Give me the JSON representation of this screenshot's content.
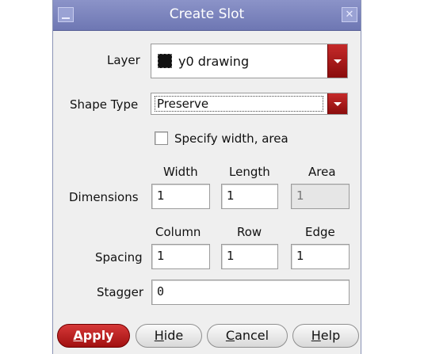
{
  "window": {
    "title": "Create Slot"
  },
  "layer": {
    "label": "Layer",
    "value": "y0 drawing"
  },
  "shape_type": {
    "label": "Shape Type",
    "value": "Preserve"
  },
  "specify": {
    "label": "Specify width, area",
    "checked": false
  },
  "dimensions": {
    "label": "Dimensions",
    "headers": [
      "Width",
      "Length",
      "Area"
    ],
    "values": [
      "1",
      "1",
      "1"
    ]
  },
  "spacing": {
    "label": "Spacing",
    "headers": [
      "Column",
      "Row",
      "Edge"
    ],
    "values": [
      "1",
      "1",
      "1"
    ]
  },
  "stagger": {
    "label": "Stagger",
    "value": "0"
  },
  "buttons": {
    "apply": {
      "mnemonic": "A",
      "rest": "pply"
    },
    "hide": {
      "mnemonic": "H",
      "rest": "ide"
    },
    "cancel": {
      "mnemonic": "C",
      "rest": "ancel"
    },
    "help": {
      "mnemonic": "H",
      "rest": "elp"
    }
  }
}
